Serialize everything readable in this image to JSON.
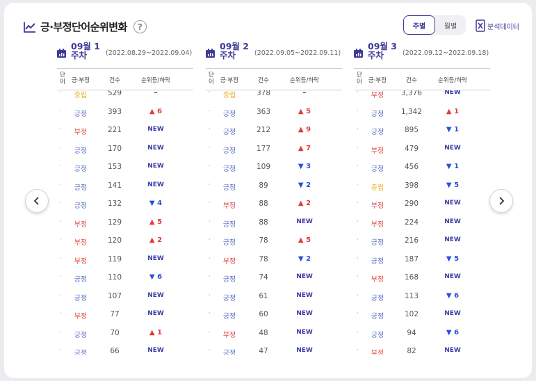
{
  "header": {
    "title": "긍·부정단어순위변화",
    "help_label": "?",
    "toggle": {
      "weekly": "주별",
      "monthly": "월별"
    },
    "export_label": "분석데이터"
  },
  "columns_header": {
    "word": "단어",
    "sentiment": "긍·부정",
    "count": "건수",
    "change": "순위등/하락"
  },
  "weeks": [
    {
      "label": "09월 1 주차",
      "range": "(2022.08.29~2022.09.04)",
      "rows": [
        {
          "word": "·",
          "sentiment": "중립",
          "count": "529",
          "change": "–"
        },
        {
          "word": "·",
          "sentiment": "긍정",
          "count": "393",
          "change": "▲ 6"
        },
        {
          "word": "·",
          "sentiment": "부정",
          "count": "221",
          "change": "NEW"
        },
        {
          "word": "·",
          "sentiment": "긍정",
          "count": "170",
          "change": "NEW"
        },
        {
          "word": "·",
          "sentiment": "긍정",
          "count": "153",
          "change": "NEW"
        },
        {
          "word": "·",
          "sentiment": "긍정",
          "count": "141",
          "change": "NEW"
        },
        {
          "word": "·",
          "sentiment": "긍정",
          "count": "132",
          "change": "▼ 4"
        },
        {
          "word": "·",
          "sentiment": "부정",
          "count": "129",
          "change": "▲ 5"
        },
        {
          "word": "·",
          "sentiment": "부정",
          "count": "120",
          "change": "▲ 2"
        },
        {
          "word": "·",
          "sentiment": "부정",
          "count": "119",
          "change": "NEW"
        },
        {
          "word": "·",
          "sentiment": "긍정",
          "count": "110",
          "change": "▼ 6"
        },
        {
          "word": "·",
          "sentiment": "긍정",
          "count": "107",
          "change": "NEW"
        },
        {
          "word": "·",
          "sentiment": "부정",
          "count": "77",
          "change": "NEW"
        },
        {
          "word": "·",
          "sentiment": "긍정",
          "count": "70",
          "change": "▲ 1"
        },
        {
          "word": "·",
          "sentiment": "긍정",
          "count": "66",
          "change": "NEW"
        }
      ]
    },
    {
      "label": "09월 2 주차",
      "range": "(2022.09.05~2022.09.11)",
      "rows": [
        {
          "word": "·",
          "sentiment": "중립",
          "count": "378",
          "change": "–"
        },
        {
          "word": "·",
          "sentiment": "긍정",
          "count": "363",
          "change": "▲ 5"
        },
        {
          "word": "·",
          "sentiment": "긍정",
          "count": "212",
          "change": "▲ 9"
        },
        {
          "word": "·",
          "sentiment": "긍정",
          "count": "177",
          "change": "▲ 7"
        },
        {
          "word": "·",
          "sentiment": "긍정",
          "count": "109",
          "change": "▼ 3"
        },
        {
          "word": "·",
          "sentiment": "긍정",
          "count": "89",
          "change": "▼ 2"
        },
        {
          "word": "·",
          "sentiment": "부정",
          "count": "88",
          "change": "▲ 2"
        },
        {
          "word": "·",
          "sentiment": "긍정",
          "count": "88",
          "change": "NEW"
        },
        {
          "word": "·",
          "sentiment": "긍정",
          "count": "78",
          "change": "▲ 5"
        },
        {
          "word": "·",
          "sentiment": "부정",
          "count": "78",
          "change": "▼ 2"
        },
        {
          "word": "·",
          "sentiment": "긍정",
          "count": "74",
          "change": "NEW"
        },
        {
          "word": "·",
          "sentiment": "긍정",
          "count": "61",
          "change": "NEW"
        },
        {
          "word": "·",
          "sentiment": "긍정",
          "count": "60",
          "change": "NEW"
        },
        {
          "word": "·",
          "sentiment": "부정",
          "count": "48",
          "change": "NEW"
        },
        {
          "word": "·",
          "sentiment": "긍정",
          "count": "47",
          "change": "NEW"
        }
      ]
    },
    {
      "label": "09월 3 주차",
      "range": "(2022.09.12~2022.09.18)",
      "rows": [
        {
          "word": "·",
          "sentiment": "부정",
          "count": "3,376",
          "change": "NEW"
        },
        {
          "word": "·",
          "sentiment": "긍정",
          "count": "1,342",
          "change": "▲ 1"
        },
        {
          "word": "·",
          "sentiment": "긍정",
          "count": "895",
          "change": "▼ 1"
        },
        {
          "word": "·",
          "sentiment": "부정",
          "count": "479",
          "change": "NEW"
        },
        {
          "word": "·",
          "sentiment": "긍정",
          "count": "456",
          "change": "▼ 1"
        },
        {
          "word": "·",
          "sentiment": "중립",
          "count": "398",
          "change": "▼ 5"
        },
        {
          "word": "·",
          "sentiment": "부정",
          "count": "290",
          "change": "NEW"
        },
        {
          "word": "·",
          "sentiment": "부정",
          "count": "224",
          "change": "NEW"
        },
        {
          "word": "·",
          "sentiment": "긍정",
          "count": "216",
          "change": "NEW"
        },
        {
          "word": "·",
          "sentiment": "긍정",
          "count": "187",
          "change": "▼ 5"
        },
        {
          "word": "·",
          "sentiment": "부정",
          "count": "168",
          "change": "NEW"
        },
        {
          "word": "·",
          "sentiment": "긍정",
          "count": "113",
          "change": "▼ 6"
        },
        {
          "word": "·",
          "sentiment": "긍정",
          "count": "102",
          "change": "NEW"
        },
        {
          "word": "·",
          "sentiment": "긍정",
          "count": "94",
          "change": "▼ 6"
        },
        {
          "word": "·",
          "sentiment": "부정",
          "count": "82",
          "change": "NEW"
        }
      ]
    }
  ],
  "icons": {
    "title": "line-chart-icon",
    "week": "calendar-chart-icon",
    "export": "excel-icon",
    "prev": "chevron-left-icon",
    "next": "chevron-right-icon"
  },
  "colors": {
    "accent": "#3e3b98",
    "positive": "#5b6fc4",
    "negative": "#e24b4b",
    "neutral": "#e8b324",
    "up": "#e03b3b",
    "down": "#2a4fd6"
  }
}
